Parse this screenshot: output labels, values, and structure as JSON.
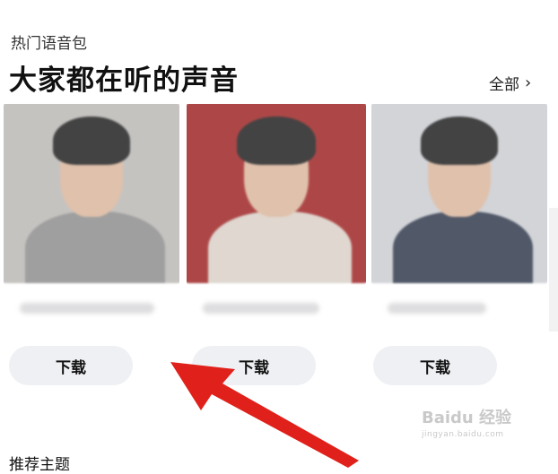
{
  "section": {
    "subtitle": "热门语音包",
    "title": "大家都在听的声音",
    "see_all_label": "全部"
  },
  "icons": {
    "see_all_chevron": "chevron-right-icon",
    "annotation": "red-arrow-icon"
  },
  "cards": [
    {
      "photo_bg": "#b9b6b3",
      "body_color": "#8a8a8a",
      "download_label": "下载"
    },
    {
      "photo_bg": "#9c1f1f",
      "body_color": "#d8cfc6",
      "download_label": "下载"
    },
    {
      "photo_bg": "#c9cbd0",
      "body_color": "#2b3447",
      "download_label": "下载"
    }
  ],
  "next_section_label": "推荐主题",
  "watermark": {
    "text": "Baidu 经验",
    "url_text": "jingyan.baidu.com"
  },
  "colors": {
    "arrow": "#e0201a",
    "download_button_bg": "#eef0f3"
  }
}
